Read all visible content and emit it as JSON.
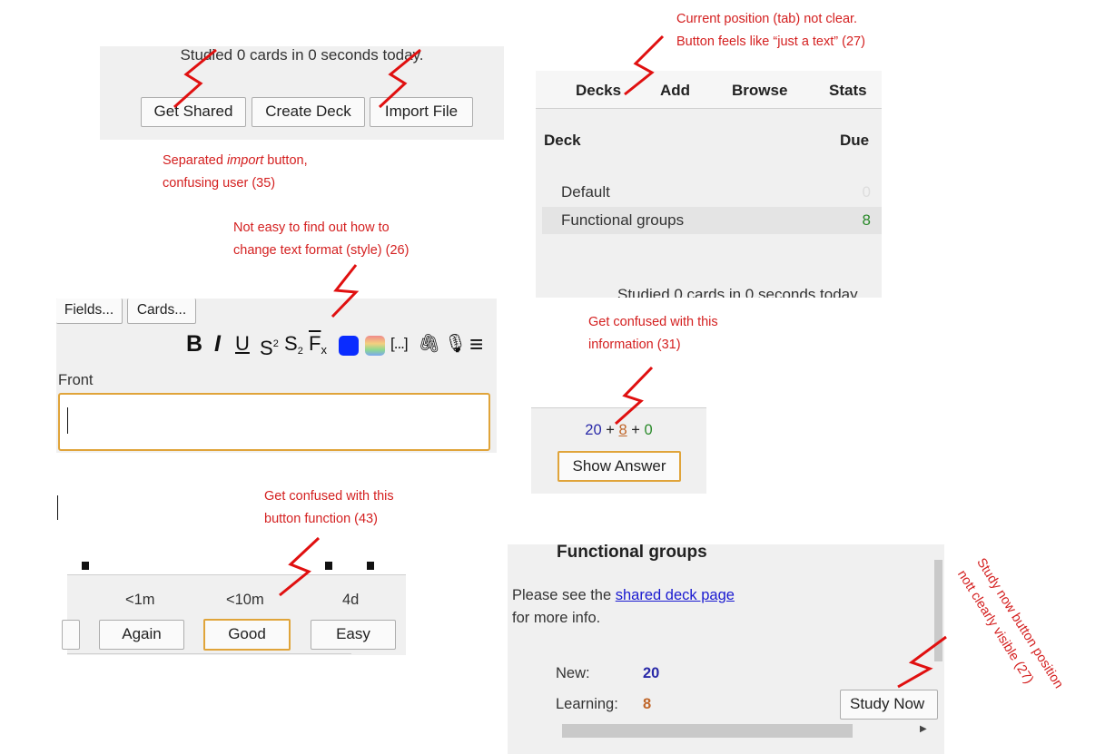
{
  "panels": {
    "study_screen": {
      "studied": "Studied 0 cards in 0 seconds today.",
      "buttons": [
        "Get Shared",
        "Create Deck",
        "Import File"
      ]
    },
    "deck_tabs": {
      "tabs": [
        "Decks",
        "Add",
        "Browse",
        "Stats"
      ],
      "col_deck": "Deck",
      "col_due": "Due",
      "rows": [
        {
          "name": "Default",
          "due": "0"
        },
        {
          "name": "Functional groups",
          "due": "8"
        }
      ],
      "studied_partial": "Studied 0 cards in 0 seconds today"
    },
    "editor": {
      "fields_button": "Fields...",
      "cards_button": "Cards...",
      "toolbar": {
        "bold": "B",
        "italic": "I",
        "underline": "U",
        "superscript": "S",
        "superscript_mark": "2",
        "subscript": "S",
        "subscript_mark": "2",
        "clear_format": "F",
        "clear_format_mark": "x",
        "cloze": "[...]",
        "attach": "🖇",
        "record": "🎙",
        "more": "≡"
      },
      "front_label": "Front",
      "front_value": ""
    },
    "counts": {
      "new": "20",
      "plus1": "+",
      "learning": "8",
      "plus2": "+",
      "review": "0",
      "show_answer": "Show Answer"
    },
    "answer_buttons": {
      "intervals": [
        "<1m",
        "<10m",
        "4d"
      ],
      "buttons": [
        "Again",
        "Good",
        "Easy"
      ]
    },
    "overview": {
      "title": "Functional groups",
      "info_prefix": "Please see the ",
      "info_link": "shared deck page",
      "info_suffix": "for more info.",
      "new_label": "New:",
      "new_value": "20",
      "learning_label": "Learning:",
      "learning_value": "8",
      "study_now": "Study Now"
    }
  },
  "annotations": {
    "tab_position": [
      "Current position (tab) not clear.",
      "Button feels like “just a text” (27)"
    ],
    "import_button": {
      "line1_prefix": "Separated ",
      "line1_em": "import",
      "line1_suffix": " button,",
      "line2": "confusing user (35)"
    },
    "text_format": [
      "Not easy to find out how to",
      "change text format (style) (26)"
    ],
    "counts_info": [
      "Get confused with this",
      "information (31)"
    ],
    "answer_button": [
      "Get confused with this",
      "button function (43)"
    ],
    "study_now": [
      "Study now button position",
      "nott clearly visible (27)"
    ]
  },
  "colors": {
    "annotation": "#d42020",
    "new_count": "#2929a8",
    "learning_count": "#c0662a",
    "review_count": "#2a8a2a",
    "link": "#1a1ad0",
    "focus_border": "#e0a43a",
    "panel_bg": "#f0f0f0"
  },
  "icons": [
    "zigzag-arrow-icon",
    "color-swatch-icon",
    "gradient-swatch-icon",
    "paperclip-icon",
    "microphone-icon",
    "menu-icon"
  ]
}
